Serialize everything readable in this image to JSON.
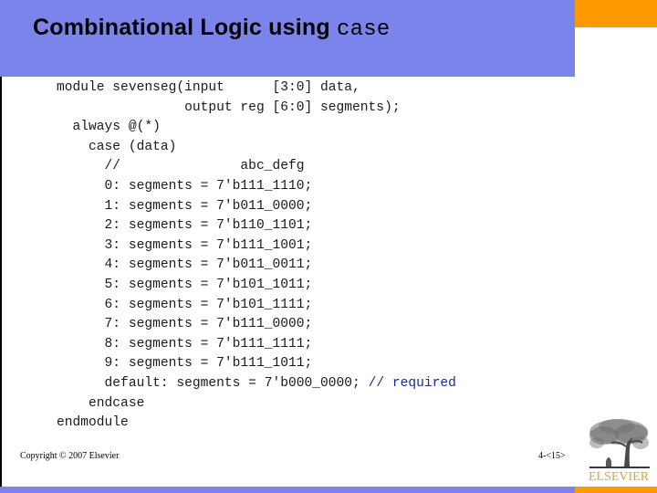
{
  "slide": {
    "title_text": "Combinational Logic using",
    "title_code_word": "case",
    "colors": {
      "header": "#7b84ea",
      "accent": "#ff9900",
      "comment": "#1f2a8a",
      "logo": "#e0a33a"
    }
  },
  "code": {
    "lines": [
      {
        "text": "module sevenseg(input      [3:0] data,"
      },
      {
        "text": "                output reg [6:0] segments);"
      },
      {
        "text": "  always @(*)"
      },
      {
        "text": "    case (data)"
      },
      {
        "text": "      //               abc_defg"
      },
      {
        "text": "      0: segments = 7'b111_1110;"
      },
      {
        "text": "      1: segments = 7'b011_0000;"
      },
      {
        "text": "      2: segments = 7'b110_1101;"
      },
      {
        "text": "      3: segments = 7'b111_1001;"
      },
      {
        "text": "      4: segments = 7'b011_0011;"
      },
      {
        "text": "      5: segments = 7'b101_1011;"
      },
      {
        "text": "      6: segments = 7'b101_1111;"
      },
      {
        "text": "      7: segments = 7'b111_0000;"
      },
      {
        "text": "      8: segments = 7'b111_1111;"
      },
      {
        "text": "      9: segments = 7'b111_1011;"
      },
      {
        "text": "      default: segments = 7'b000_0000; ",
        "comment": "// required"
      },
      {
        "text": "    endcase"
      },
      {
        "text": "endmodule"
      }
    ]
  },
  "footer": {
    "copyright": "Copyright © 2007 Elsevier",
    "page_number": "4-<15>",
    "logo_text": "ELSEVIER",
    "logo_icon": "elsevier-tree-icon"
  }
}
